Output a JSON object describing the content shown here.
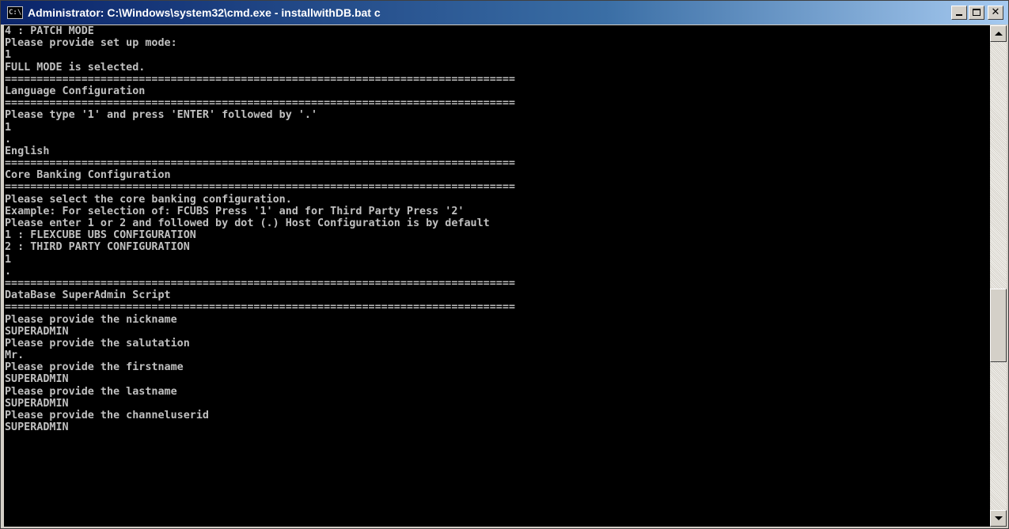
{
  "window": {
    "title": "Administrator: C:\\Windows\\system32\\cmd.exe - installwithDB.bat  c",
    "app_icon_text": "C:\\"
  },
  "controls": {
    "minimize": "minimize-icon",
    "maximize": "maximize-icon",
    "close": "✕"
  },
  "console": {
    "lines": [
      "4 : PATCH MODE",
      "Please provide set up mode:",
      "1",
      "FULL MODE is selected.",
      "================================================================================",
      "Language Configuration",
      "================================================================================",
      "Please type '1' and press 'ENTER' followed by '.'",
      "1",
      ".",
      "English",
      "================================================================================",
      "Core Banking Configuration",
      "================================================================================",
      "Please select the core banking configuration.",
      "Example: For selection of: FCUBS Press '1' and for Third Party Press '2'",
      "Please enter 1 or 2 and followed by dot (.) Host Configuration is by default",
      "1 : FLEXCUBE UBS CONFIGURATION",
      "2 : THIRD PARTY CONFIGURATION",
      "1",
      ".",
      "================================================================================",
      "DataBase SuperAdmin Script",
      "================================================================================",
      "Please provide the nickname",
      "SUPERADMIN",
      "Please provide the salutation",
      "Mr.",
      "Please provide the firstname",
      "SUPERADMIN",
      "Please provide the lastname",
      "SUPERADMIN",
      "Please provide the channeluserid",
      "SUPERADMIN"
    ]
  },
  "colors": {
    "console_bg": "#000000",
    "console_fg": "#c0c0c0",
    "titlebar_start": "#0a246a",
    "titlebar_end": "#a6caf0"
  },
  "scrollbar": {
    "position_fraction": 0.62
  }
}
